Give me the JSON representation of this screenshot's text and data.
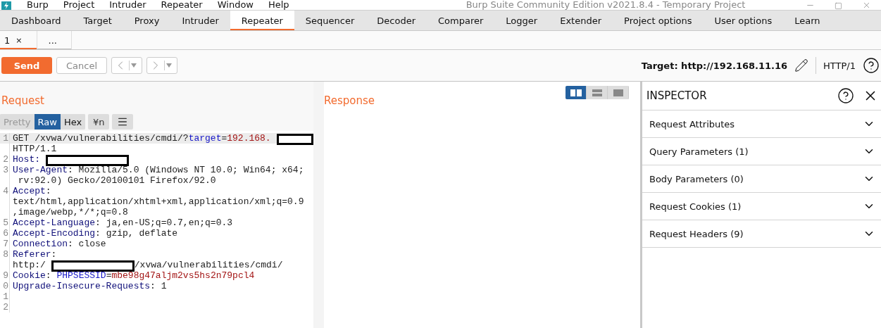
{
  "window": {
    "title": "Burp Suite Community Edition v2021.8.4 - Temporary Project"
  },
  "menu": [
    "Burp",
    "Project",
    "Intruder",
    "Repeater",
    "Window",
    "Help"
  ],
  "tabs": [
    {
      "label": "Dashboard",
      "selected": false
    },
    {
      "label": "Target",
      "selected": false
    },
    {
      "label": "Proxy",
      "selected": false
    },
    {
      "label": "Intruder",
      "selected": false
    },
    {
      "label": "Repeater",
      "selected": true
    },
    {
      "label": "Sequencer",
      "selected": false
    },
    {
      "label": "Decoder",
      "selected": false
    },
    {
      "label": "Comparer",
      "selected": false
    },
    {
      "label": "Logger",
      "selected": false
    },
    {
      "label": "Extender",
      "selected": false
    },
    {
      "label": "Project options",
      "selected": false
    },
    {
      "label": "User options",
      "selected": false
    },
    {
      "label": "Learn",
      "selected": false
    }
  ],
  "subtabs": [
    {
      "label": "1",
      "close": "×",
      "selected": true
    },
    {
      "label": "...",
      "selected": false
    }
  ],
  "toolbar": {
    "send": "Send",
    "cancel": "Cancel",
    "target": "Target: http://192.168.11.16",
    "protocol": "HTTP/1"
  },
  "request": {
    "title": "Request",
    "view_tabs": [
      {
        "label": "Pretty",
        "selected": false,
        "disabled": true
      },
      {
        "label": "Raw",
        "selected": true,
        "disabled": false
      },
      {
        "label": "Hex",
        "selected": false,
        "disabled": false
      }
    ],
    "newline_toggle": "¥n",
    "lines": [
      {
        "number": "1",
        "segments": [
          {
            "kind": "plain",
            "text": "GET /xvwa/vulnerabilities/cmdi/?"
          },
          {
            "kind": "param",
            "text": "target"
          },
          {
            "kind": "plain",
            "text": "="
          },
          {
            "kind": "value",
            "text": "192.168."
          },
          {
            "kind": "redacted"
          }
        ]
      },
      {
        "segments": [
          {
            "kind": "plain",
            "text": "HTTP/1.1"
          }
        ]
      },
      {
        "number": "2",
        "segments": [
          {
            "kind": "header",
            "text": "Host:"
          },
          {
            "kind": "redacted"
          }
        ]
      },
      {
        "number": "3",
        "segments": [
          {
            "kind": "header",
            "text": "User-Agent"
          },
          {
            "kind": "plain",
            "text": ": Mozilla/5.0 (Windows NT 10.0; Win64; x64;"
          }
        ]
      },
      {
        "segments": [
          {
            "kind": "plain",
            "text": " rv:92.0) Gecko/20100101 Firefox/92.0"
          }
        ]
      },
      {
        "number": "4",
        "segments": [
          {
            "kind": "header",
            "text": "Accept"
          },
          {
            "kind": "plain",
            "text": ":"
          }
        ]
      },
      {
        "segments": [
          {
            "kind": "plain",
            "text": "text/html,application/xhtml+xml,application/xml;q=0.9"
          }
        ]
      },
      {
        "segments": [
          {
            "kind": "plain",
            "text": ",image/webp,*/*;q=0.8"
          }
        ]
      },
      {
        "number": "5",
        "segments": [
          {
            "kind": "header",
            "text": "Accept-Language"
          },
          {
            "kind": "plain",
            "text": ": ja,en-US;q=0.7,en;q=0.3"
          }
        ]
      },
      {
        "number": "6",
        "segments": [
          {
            "kind": "header",
            "text": "Accept-Encoding"
          },
          {
            "kind": "plain",
            "text": ": gzip, deflate"
          }
        ]
      },
      {
        "number": "7",
        "segments": [
          {
            "kind": "header",
            "text": "Connection"
          },
          {
            "kind": "plain",
            "text": ": close"
          }
        ]
      },
      {
        "number": "8",
        "segments": [
          {
            "kind": "header",
            "text": "Referer"
          },
          {
            "kind": "plain",
            "text": ":"
          }
        ]
      },
      {
        "segments": [
          {
            "kind": "plain",
            "text": "http:/"
          },
          {
            "kind": "redacted"
          },
          {
            "kind": "plain",
            "text": "/xvwa/vulnerabilities/cmdi/"
          }
        ]
      },
      {
        "number": "9",
        "segments": [
          {
            "kind": "header",
            "text": "Cookie"
          },
          {
            "kind": "plain",
            "text": ": "
          },
          {
            "kind": "param",
            "text": "PHPSESSID"
          },
          {
            "kind": "plain",
            "text": "="
          },
          {
            "kind": "value",
            "text": "mbe98g47aljm2vs5hs2n79pcl4"
          }
        ]
      },
      {
        "number": "0",
        "segments": [
          {
            "kind": "header",
            "text": "Upgrade-Insecure-Requests"
          },
          {
            "kind": "plain",
            "text": ": 1"
          }
        ]
      },
      {
        "number": "1"
      },
      {
        "number": "2"
      }
    ]
  },
  "response": {
    "title": "Response"
  },
  "layout_modes": [
    {
      "kind": "columns",
      "selected": true
    },
    {
      "kind": "rows",
      "selected": false
    },
    {
      "kind": "single",
      "selected": false
    }
  ],
  "inspector": {
    "title": "INSPECTOR",
    "sections": [
      {
        "label": "Request Attributes",
        "expanded": false
      },
      {
        "label": "Query Parameters (1)",
        "expanded": false
      },
      {
        "label": "Body Parameters (0)",
        "expanded": false
      },
      {
        "label": "Request Cookies (1)",
        "expanded": false
      },
      {
        "label": "Request Headers (9)",
        "expanded": false
      }
    ]
  }
}
